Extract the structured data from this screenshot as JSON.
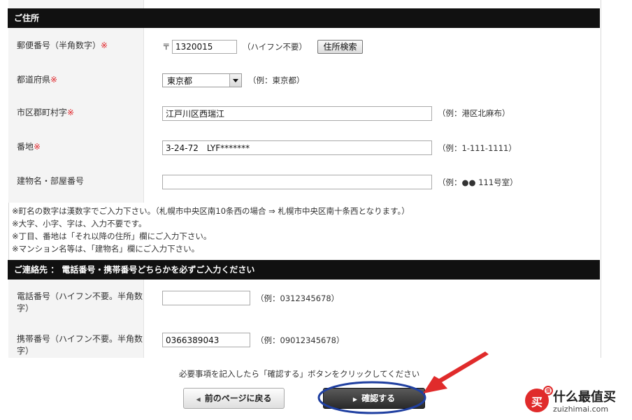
{
  "address_section": {
    "title": "ご住所",
    "postal": {
      "label": "郵便番号（半角数字）",
      "required_mark": "※",
      "prefix": "〒",
      "value": "1320015",
      "hint": "（ハイフン不要）",
      "search_button": "住所検索"
    },
    "prefecture": {
      "label": "都道府県",
      "required_mark": "※",
      "value": "東京都",
      "hint": "（例：東京都）"
    },
    "city": {
      "label": "市区郡町村字",
      "required_mark": "※",
      "value": "江戸川区西瑞江",
      "hint": "（例：港区北麻布）"
    },
    "street": {
      "label": "番地",
      "required_mark": "※",
      "value": "3-24-72　LYF*******",
      "hint": "（例：1-111-1111）"
    },
    "building": {
      "label": "建物名・部屋番号",
      "value": "",
      "hint": "（例：●● 111号室）"
    },
    "notes": [
      "※町名の数字は漢数字でご入力下さい。（札幌市中央区南10条西の場合 ⇒ 札幌市中央区南十条西となります。）",
      "※大字、小字、字は、入力不要です。",
      "※丁目、番地は「それ以降の住所」欄にご入力下さい。",
      "※マンション名等は、「建物名」欄にご入力下さい。"
    ]
  },
  "contact_section": {
    "title": "ご連絡先 ： 電話番号・携帯番号どちらかを必ずご入力ください",
    "phone": {
      "label_line1": "電話番号（ハイフン不要。半角数",
      "label_line2": "字）",
      "value": "",
      "hint": "（例：0312345678）"
    },
    "mobile": {
      "label_line1": "携帯番号（ハイフン不要。半角数",
      "label_line2": "字）",
      "value": "0366389043",
      "hint": "（例：09012345678）"
    }
  },
  "footer": {
    "instruction": "必要事項を記入したら「確認する」ボタンをクリックしてください",
    "back_button": "前のページに戻る",
    "confirm_button": "確認する"
  },
  "watermark": {
    "badge": "值",
    "icon_char": "买",
    "text": "什么最值买",
    "domain": "zuizhimai.com"
  },
  "colors": {
    "header_bg": "#111111",
    "required": "#e0262b",
    "annotation": "#1f3fa0",
    "arrow": "#e02b2b"
  }
}
